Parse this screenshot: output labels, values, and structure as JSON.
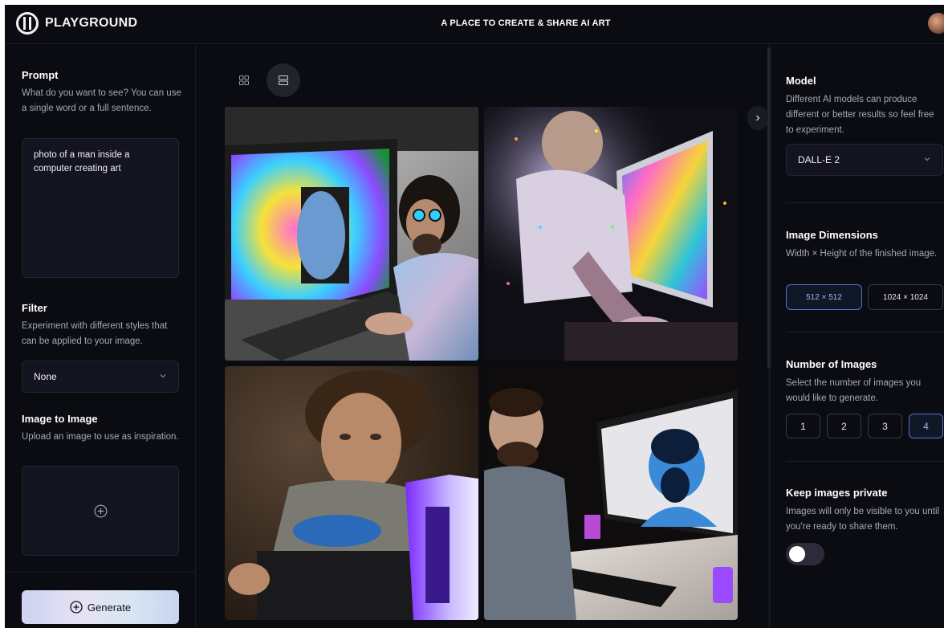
{
  "header": {
    "brand": "PLAYGROUND",
    "tagline": "A PLACE TO CREATE & SHARE AI ART"
  },
  "left_panel": {
    "prompt": {
      "title": "Prompt",
      "description": "What do you want to see? You can use a single word or a full sentence.",
      "value": "photo of a man inside a computer creating art"
    },
    "filter": {
      "title": "Filter",
      "description": "Experiment with different styles that can be applied to your image.",
      "selected": "None"
    },
    "image_to_image": {
      "title": "Image to Image",
      "description": "Upload an image to use as inspiration."
    },
    "generate_label": "Generate"
  },
  "gallery": {
    "view_mode": "large",
    "images": [
      {
        "icon": "generated-image-1"
      },
      {
        "icon": "generated-image-2"
      },
      {
        "icon": "generated-image-3"
      },
      {
        "icon": "generated-image-4"
      }
    ]
  },
  "right_panel": {
    "model": {
      "title": "Model",
      "description": "Different AI models can produce different or better results so feel free to experiment.",
      "selected": "DALL-E 2"
    },
    "dimensions": {
      "title": "Image Dimensions",
      "description": "Width × Height of the finished image.",
      "options": [
        "512 × 512",
        "1024 × 1024"
      ],
      "selected": "512 × 512"
    },
    "num_images": {
      "title": "Number of Images",
      "description": "Select the number of images you would like to generate.",
      "options": [
        "1",
        "2",
        "3",
        "4"
      ],
      "selected": "4"
    },
    "private": {
      "title": "Keep images private",
      "description": "Images will only be visible to you until you're ready to share them.",
      "enabled": false
    }
  },
  "colors": {
    "background": "#0b0b12",
    "panel_input": "#141420",
    "accent_selected": "#5a74c8"
  }
}
